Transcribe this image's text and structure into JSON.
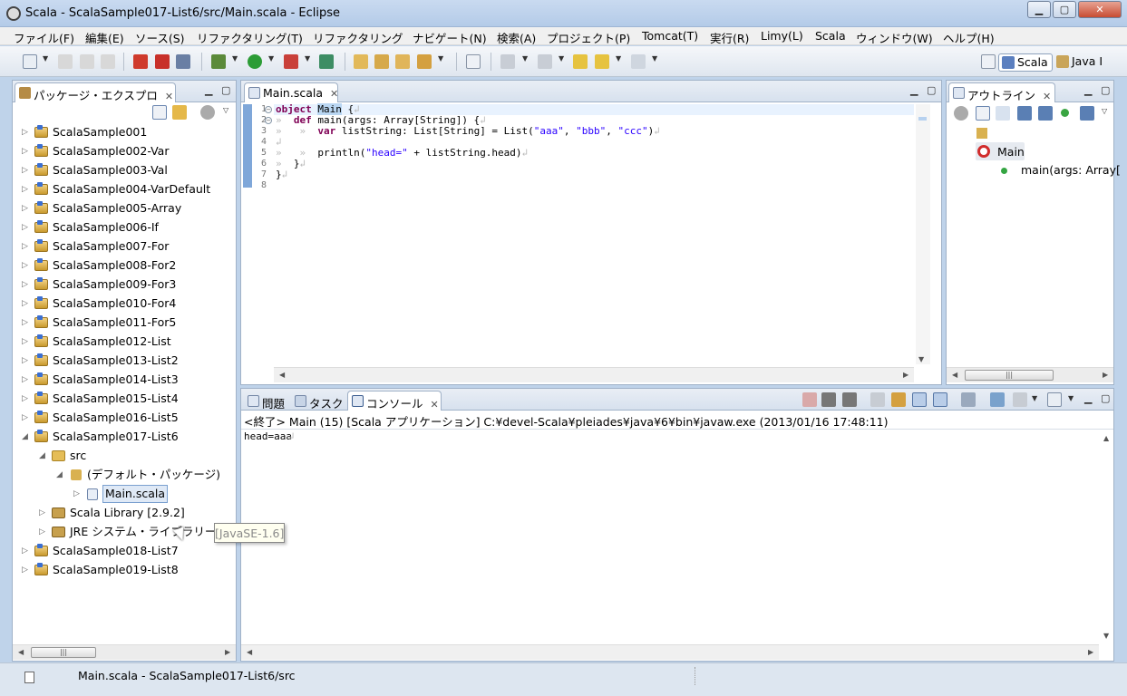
{
  "window": {
    "title": "Scala - ScalaSample017-List6/src/Main.scala - Eclipse"
  },
  "menu": [
    "ファイル(F)",
    "編集(E)",
    "ソース(S)",
    "リファクタリング(T)",
    "リファクタリング",
    "ナビゲート(N)",
    "検索(A)",
    "プロジェクト(P)",
    "Tomcat(T)",
    "実行(R)",
    "Limy(L)",
    "Scala",
    "ウィンドウ(W)",
    "ヘルプ(H)"
  ],
  "perspectives": {
    "scala": "Scala",
    "java": "Java I"
  },
  "package_explorer": {
    "tab_label": "パッケージ・エクスプロ",
    "projects": [
      "ScalaSample001",
      "ScalaSample002-Var",
      "ScalaSample003-Val",
      "ScalaSample004-VarDefault",
      "ScalaSample005-Array",
      "ScalaSample006-If",
      "ScalaSample007-For",
      "ScalaSample008-For2",
      "ScalaSample009-For3",
      "ScalaSample010-For4",
      "ScalaSample011-For5",
      "ScalaSample012-List",
      "ScalaSample013-List2",
      "ScalaSample014-List3",
      "ScalaSample015-List4",
      "ScalaSample016-List5",
      "ScalaSample017-List6"
    ],
    "src": "src",
    "default_package": "(デフォルト・パッケージ)",
    "file": "Main.scala",
    "scala_library": "Scala Library [2.9.2]",
    "jre": "JRE システム・ライブラリー",
    "jre_tooltip": "[JavaSE-1.6]",
    "projects_after": [
      "ScalaSample018-List7",
      "ScalaSample019-List8"
    ]
  },
  "editor": {
    "tab_label": "Main.scala",
    "line_numbers": [
      "1",
      "2",
      "3",
      "4",
      "5",
      "6",
      "7",
      "8"
    ]
  },
  "outline": {
    "tab_label": "アウトライン",
    "object": "Main",
    "method": "main(args: Array["
  },
  "bottom": {
    "tabs": [
      "問題",
      "タスク",
      "コンソール"
    ],
    "console_header": "<終了> Main (15) [Scala アプリケーション] C:¥devel-Scala¥pleiades¥java¥6¥bin¥javaw.exe (2013/01/16 17:48:11)",
    "console_output": "head=aaa"
  },
  "status": {
    "text": "Main.scala - ScalaSample017-List6/src"
  }
}
